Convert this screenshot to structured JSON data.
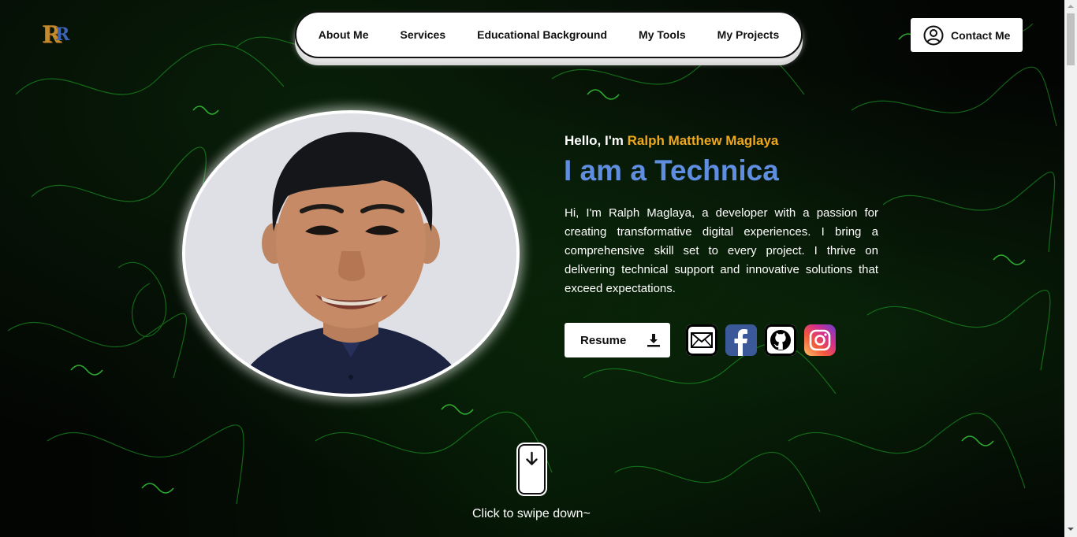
{
  "header": {
    "logo_alt": "R",
    "nav": [
      {
        "label": "About Me"
      },
      {
        "label": "Services"
      },
      {
        "label": "Educational Background"
      },
      {
        "label": "My Tools"
      },
      {
        "label": "My Projects"
      }
    ],
    "contact_label": "Contact Me"
  },
  "hero": {
    "greeting": "Hello, I'm",
    "name": "Ralph Matthew Maglaya",
    "role_typed": "I am a Technica",
    "bio": "Hi, I'm Ralph Maglaya, a developer with a passion for creating transformative digital experiences. I bring a comprehensive skill set to every project. I thrive on delivering technical support and innovative solutions that exceed expectations.",
    "resume_label": "Resume"
  },
  "socials": [
    {
      "icon": "email-icon"
    },
    {
      "icon": "facebook-icon"
    },
    {
      "icon": "github-icon"
    },
    {
      "icon": "instagram-icon"
    }
  ],
  "scroll": {
    "hint": "Click to swipe down~"
  },
  "colors": {
    "accent_name": "#f0a81c",
    "accent_role": "#5f8ee0",
    "background": "#030503",
    "glow": "#22c322"
  }
}
